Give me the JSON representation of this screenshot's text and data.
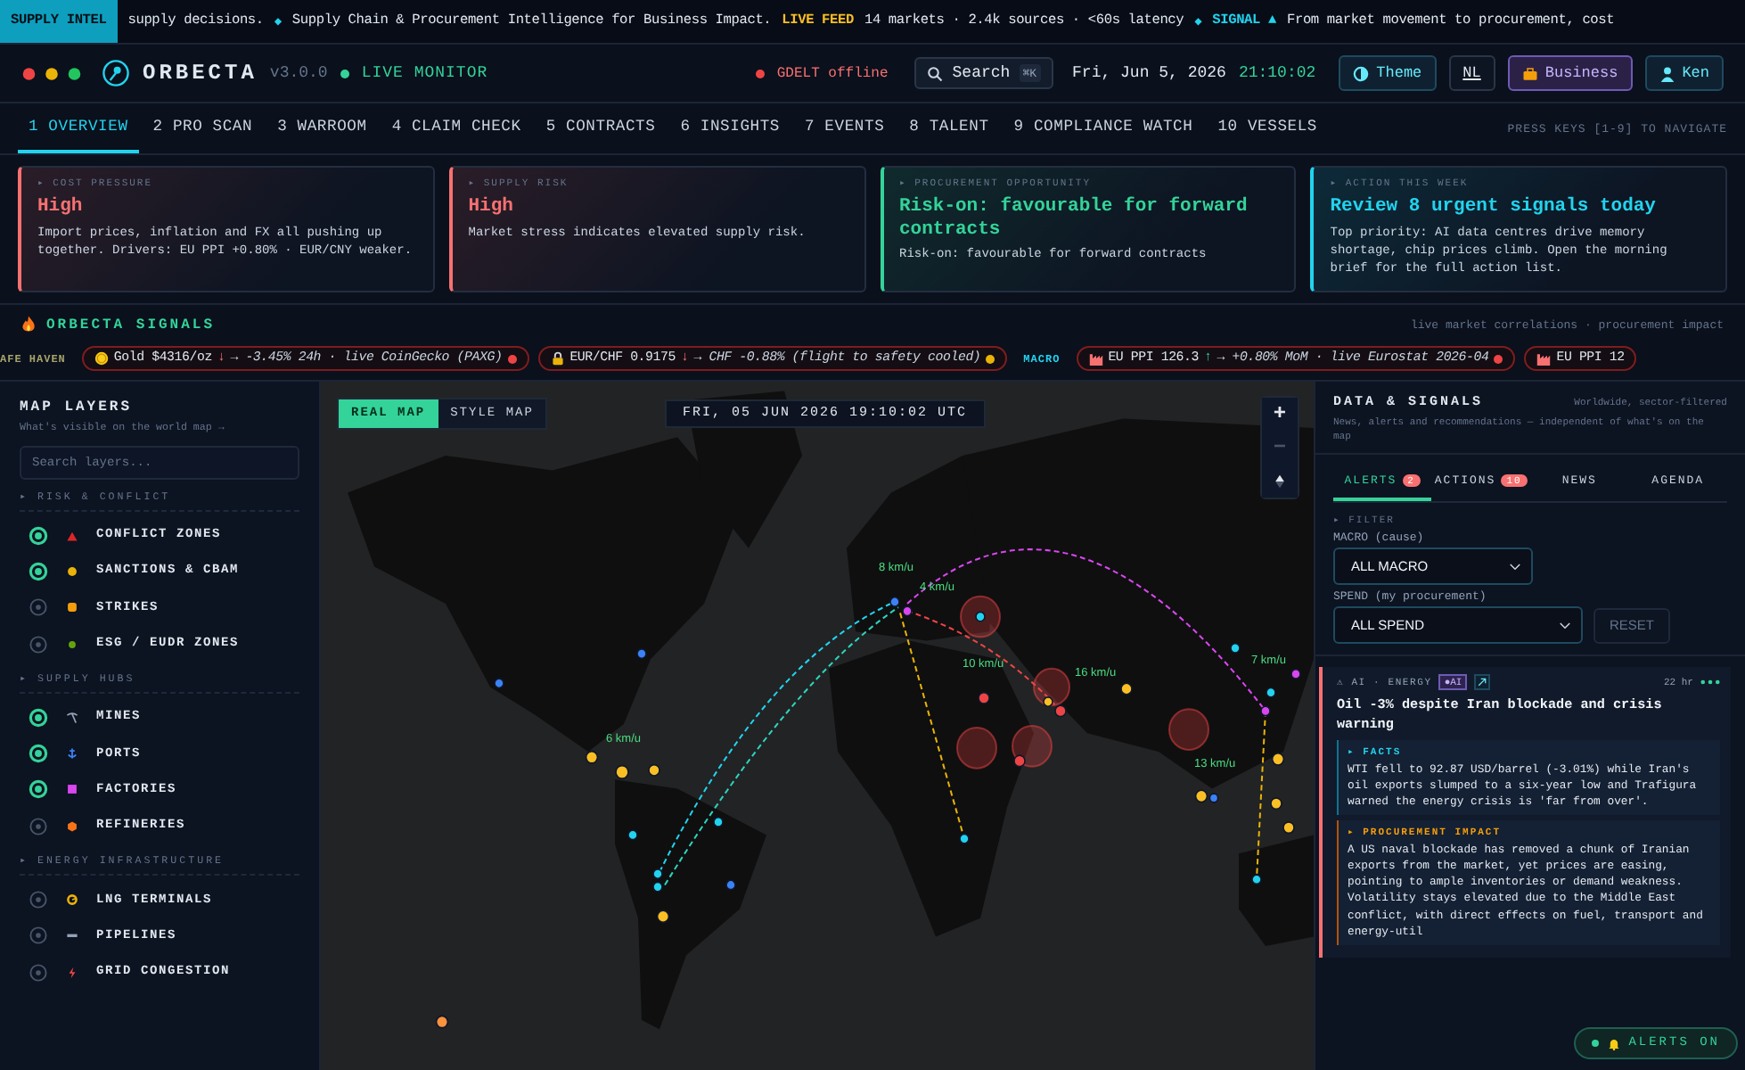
{
  "ticker": {
    "label": "SUPPLY INTEL",
    "items": [
      {
        "kind": "plain",
        "text": "supply decisions."
      },
      {
        "kind": "sep",
        "text": "◆"
      },
      {
        "kind": "plain",
        "text": "Supply Chain & Procurement Intelligence for Business Impact."
      },
      {
        "kind": "feed",
        "text": "LIVE FEED"
      },
      {
        "kind": "plain",
        "text": "14 markets · 2.4k sources · <60s latency"
      },
      {
        "kind": "sep",
        "text": "◆"
      },
      {
        "kind": "signal",
        "text": "SIGNAL ▲"
      },
      {
        "kind": "plain",
        "text": "From market movement to procurement, cost"
      }
    ]
  },
  "header": {
    "brand": "ORBECTA",
    "version": "v3.0.0",
    "live": "LIVE MONITOR",
    "gdelt": "GDELT offline",
    "search": {
      "label": "Search",
      "shortcut": "⌘K"
    },
    "date": "Fri, Jun 5, 2026",
    "time": "21:10:02",
    "buttons": [
      {
        "kind": "theme",
        "label": "Theme"
      },
      {
        "kind": "lang",
        "label": "NL"
      },
      {
        "kind": "mode",
        "label": "Business"
      },
      {
        "kind": "user",
        "label": "Ken"
      }
    ]
  },
  "tabs": [
    {
      "key": "1",
      "label": "OVERVIEW",
      "selected": true
    },
    {
      "key": "2",
      "label": "PRO SCAN",
      "selected": false
    },
    {
      "key": "3",
      "label": "WARROOM",
      "selected": false
    },
    {
      "key": "4",
      "label": "CLAIM CHECK",
      "selected": false
    },
    {
      "key": "5",
      "label": "CONTRACTS",
      "selected": false
    },
    {
      "key": "6",
      "label": "INSIGHTS",
      "selected": false
    },
    {
      "key": "7",
      "label": "EVENTS",
      "selected": false
    },
    {
      "key": "8",
      "label": "TALENT",
      "selected": false
    },
    {
      "key": "9",
      "label": "COMPLIANCE WATCH",
      "selected": false
    },
    {
      "key": "10",
      "label": "VESSELS",
      "selected": false
    }
  ],
  "nav_hint": "PRESS KEYS [1-9] TO NAVIGATE",
  "cards": [
    {
      "label": "▸ COST PRESSURE",
      "title": "High",
      "body": "Import prices, inflation and FX all pushing up together. Drivers: EU PPI +0.80% · EUR/CNY weaker.",
      "color": "#f87171"
    },
    {
      "label": "▸ SUPPLY RISK",
      "title": "High",
      "body": "Market stress indicates elevated supply risk.",
      "color": "#f87171"
    },
    {
      "label": "▸ PROCUREMENT OPPORTUNITY",
      "title": "Risk-on: favourable for forward contracts",
      "body": "Risk-on: favourable for forward contracts",
      "color": "#34d399"
    },
    {
      "label": "▸ ACTION THIS WEEK",
      "title": "Review 8 urgent signals today",
      "body": "Top priority: AI data centres drive memory shortage, chip prices climb. Open the morning brief for the full action list.",
      "color": "#22d3ee"
    }
  ],
  "signals": {
    "title": "ORBECTA SIGNALS",
    "subtitle": "live market correlations · procurement impact",
    "row": [
      {
        "kind": "group",
        "text": "AFE HAVEN"
      },
      {
        "kind": "chip",
        "main": "Gold $4316/oz",
        "arrow": "↓",
        "rising": false,
        "detail": "→ -3.45% 24h · live CoinGecko (PAXG)",
        "color": "#ef4444"
      },
      {
        "kind": "chip",
        "main": "EUR/CHF 0.9175",
        "arrow": "↓",
        "rising": false,
        "detail": "→ CHF -0.88% (flight to safety cooled)",
        "color": "#eab308"
      },
      {
        "kind": "group",
        "text": "MACRO"
      },
      {
        "kind": "chip",
        "main": "EU PPI 126.3",
        "arrow": "↑",
        "rising": true,
        "detail": "→ +0.80% MoM · live Eurostat 2026-04",
        "color": "#ef4444"
      },
      {
        "kind": "chip",
        "main": "EU PPI 12"
      }
    ]
  },
  "sidebar": {
    "title": "MAP LAYERS",
    "subtitle": "What's visible on the world map →",
    "search_placeholder": "Search layers...",
    "groups": [
      {
        "title": "▸ RISK & CONFLICT",
        "items": [
          {
            "label": "CONFLICT ZONES",
            "on": true
          },
          {
            "label": "SANCTIONS & CBAM",
            "on": true
          },
          {
            "label": "STRIKES",
            "on": false
          },
          {
            "label": "ESG / EUDR ZONES",
            "on": false
          }
        ]
      },
      {
        "title": "▸ SUPPLY HUBS",
        "items": [
          {
            "label": "MINES",
            "on": true
          },
          {
            "label": "PORTS",
            "on": true
          },
          {
            "label": "FACTORIES",
            "on": true
          },
          {
            "label": "REFINERIES",
            "on": false
          }
        ]
      },
      {
        "title": "▸ ENERGY INFRASTRUCTURE",
        "items": [
          {
            "label": "LNG TERMINALS",
            "on": false
          },
          {
            "label": "PIPELINES",
            "on": false
          },
          {
            "label": "GRID CONGESTION",
            "on": false
          }
        ]
      }
    ]
  },
  "map": {
    "modes": [
      {
        "label": "REAL MAP",
        "selected": true
      },
      {
        "label": "STYLE MAP",
        "selected": false
      }
    ],
    "clock": "FRI, 05 JUN 2026 19:10:02 UTC",
    "zoom_in": "+",
    "zoom_out": "−",
    "speed_labels": [
      "8 km/u",
      "4 km/u",
      "10 km/u",
      "16 km/u",
      "7 km/u",
      "6 km/u",
      "13 km/u"
    ]
  },
  "panel": {
    "title": "DATA & SIGNALS",
    "scope": "Worldwide, sector-filtered",
    "subtitle": "News, alerts and recommendations — independent of what's on the map",
    "tabs": [
      {
        "label": "ALERTS",
        "count": "2",
        "selected": true
      },
      {
        "label": "ACTIONS",
        "count": "10",
        "selected": false
      },
      {
        "label": "NEWS",
        "selected": false
      },
      {
        "label": "AGENDA",
        "selected": false
      }
    ],
    "filter": {
      "heading": "▸ FILTER",
      "macro_label": "MACRO (cause)",
      "macro_value": "ALL MACRO",
      "spend_label": "SPEND (my procurement)",
      "spend_value": "ALL SPEND",
      "reset": "RESET"
    },
    "alert": {
      "category": "⚠ AI · ENERGY",
      "tag": "●AI",
      "age": "22 hr",
      "title": "Oil -3% despite Iran blockade and crisis warning",
      "facts_heading": "▸ FACTS",
      "facts": "WTI fell to 92.87 USD/barrel (-3.01%) while Iran's oil exports slumped to a six-year low and Trafigura warned the energy crisis is 'far from over'.",
      "impact_heading": "▸ PROCUREMENT IMPACT",
      "impact": "A US naval blockade has removed a chunk of Iranian exports from the market, yet prices are easing, pointing to ample inventories or demand weakness. Volatility stays elevated due to the Middle East conflict, with direct effects on fuel, transport and energy-util"
    },
    "alerts_toggle": {
      "label": "ALERTS ON",
      "on": true
    }
  }
}
